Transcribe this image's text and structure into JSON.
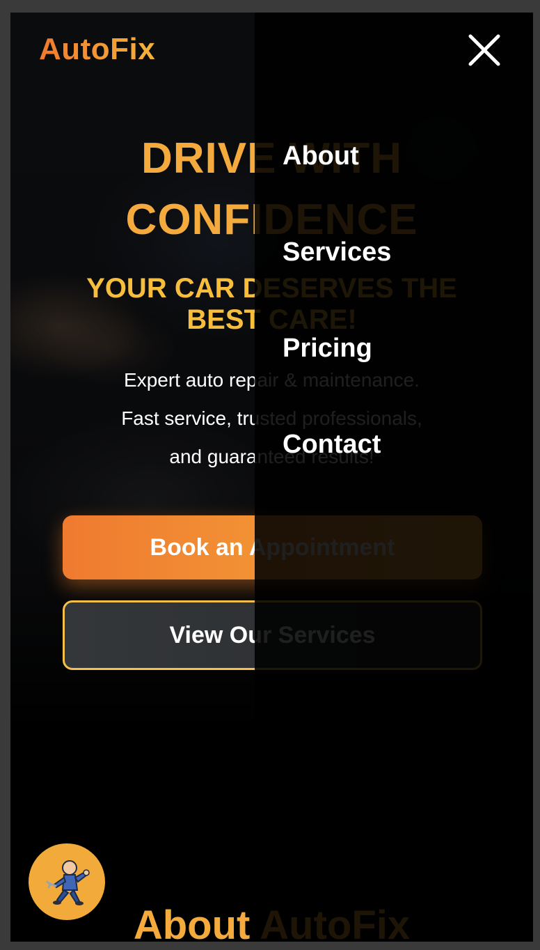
{
  "brand": {
    "logo_text": "AutoFix"
  },
  "hero": {
    "title_line1": "DRIVE WITH",
    "title_line2": "CONFIDENCE",
    "subtitle_line1": "YOUR CAR DESERVES THE",
    "subtitle_line2": "BEST CARE!",
    "desc_line1": "Expert auto repair & maintenance.",
    "desc_line2": "Fast service, trusted professionals,",
    "desc_line3": "and guaranteed results!",
    "primary_cta": "Book an Appointment",
    "secondary_cta": "View Our Services"
  },
  "nav": {
    "items": [
      {
        "label": "About"
      },
      {
        "label": "Services"
      },
      {
        "label": "Pricing"
      },
      {
        "label": "Contact"
      }
    ],
    "close_icon": "close-icon"
  },
  "about": {
    "heading": "About AutoFix"
  },
  "fab": {
    "icon": "mechanic-mascot-icon"
  },
  "colors": {
    "accent_orange": "#f07a2e",
    "accent_gold": "#f5b23c",
    "background": "#000000",
    "text": "#ffffff"
  }
}
